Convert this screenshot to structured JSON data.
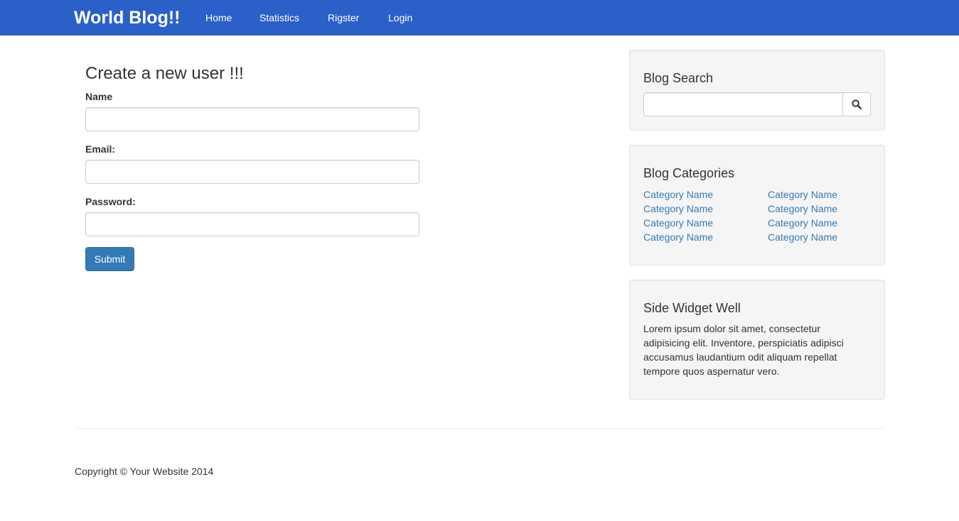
{
  "navbar": {
    "brand": "World Blog!!",
    "links": [
      "Home",
      "Statistics",
      "Rigster",
      "Login"
    ],
    "background": "#2b60c9"
  },
  "form": {
    "title": "Create a new user !!!",
    "name_label": "Name",
    "email_label": "Email:",
    "password_label": "Password:",
    "name_value": "",
    "email_value": "",
    "password_value": "",
    "submit_label": "Submit"
  },
  "sidebar": {
    "search": {
      "title": "Blog Search",
      "value": "",
      "icon": "search-icon"
    },
    "categories": {
      "title": "Blog Categories",
      "left": [
        "Category Name",
        "Category Name",
        "Category Name",
        "Category Name"
      ],
      "right": [
        "Category Name",
        "Category Name",
        "Category Name",
        "Category Name"
      ]
    },
    "widget": {
      "title": "Side Widget Well",
      "text": "Lorem ipsum dolor sit amet, consectetur adipisicing elit. Inventore, perspiciatis adipisci accusamus laudantium odit aliquam repellat tempore quos aspernatur vero."
    }
  },
  "footer": {
    "copyright": "Copyright © Your Website 2014"
  }
}
